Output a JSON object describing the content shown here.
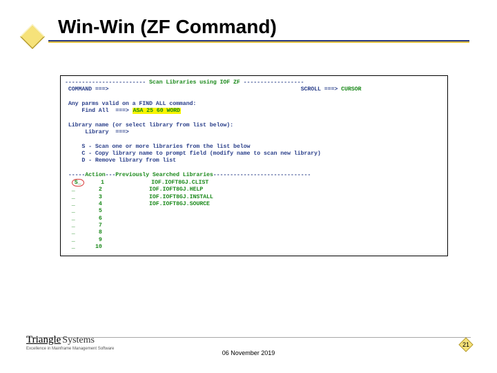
{
  "title": "Win-Win (ZF Command)",
  "terminal": {
    "header_dashes_left": "------------------------",
    "header_title": " Scan Libraries using IOF ZF ",
    "header_dashes_right": "------------------",
    "command_label": "COMMAND ===>",
    "scroll_label": "SCROLL ===>",
    "scroll_value": "CURSOR",
    "parms_note": "Any parms valid on a FIND ALL command:",
    "findall_label": "Find All  ===>",
    "findall_value": "ASA 25 60 WORD",
    "libname_note": "Library name (or select library from list below):",
    "lib_label": "Library  ===>",
    "opt_s": "S - Scan one or more libraries from the list below",
    "opt_c": "C - Copy library name to prompt field (modify name to scan new library)",
    "opt_d": "D - Remove library from list",
    "list_hdr_dashes1": "-----",
    "list_hdr_action": "Action",
    "list_hdr_dashes2": "---",
    "list_hdr_prev": "Previously Searched Libraries",
    "list_hdr_dashes3": "-----------------------------",
    "rows": [
      {
        "act": "S_",
        "num": "1",
        "dsn": "IOF.IOFT8GJ.CLIST"
      },
      {
        "act": "_",
        "num": "2",
        "dsn": "IOF.IOFT8GJ.HELP"
      },
      {
        "act": "_",
        "num": "3",
        "dsn": "IOF.IOFT8GJ.INSTALL"
      },
      {
        "act": "_",
        "num": "4",
        "dsn": "IOF.IOFT8GJ.SOURCE"
      },
      {
        "act": "_",
        "num": "5",
        "dsn": ""
      },
      {
        "act": "_",
        "num": "6",
        "dsn": ""
      },
      {
        "act": "_",
        "num": "7",
        "dsn": ""
      },
      {
        "act": "_",
        "num": "8",
        "dsn": ""
      },
      {
        "act": "_",
        "num": "9",
        "dsn": ""
      },
      {
        "act": "_",
        "num": "10",
        "dsn": ""
      }
    ]
  },
  "footer": {
    "logo_tri": "Triangle",
    "logo_sys": "Systems",
    "logo_tag": "Excellence in Mainframe Management Software",
    "date": "06 November 2019",
    "page": "21"
  },
  "colors": {
    "accent_navy": "#2b3a7f",
    "accent_gold": "#e0c040",
    "term_text": "#2a3f8a",
    "term_green": "#1c8a1c",
    "highlight": "#f7f400",
    "red": "#d93a3a"
  }
}
